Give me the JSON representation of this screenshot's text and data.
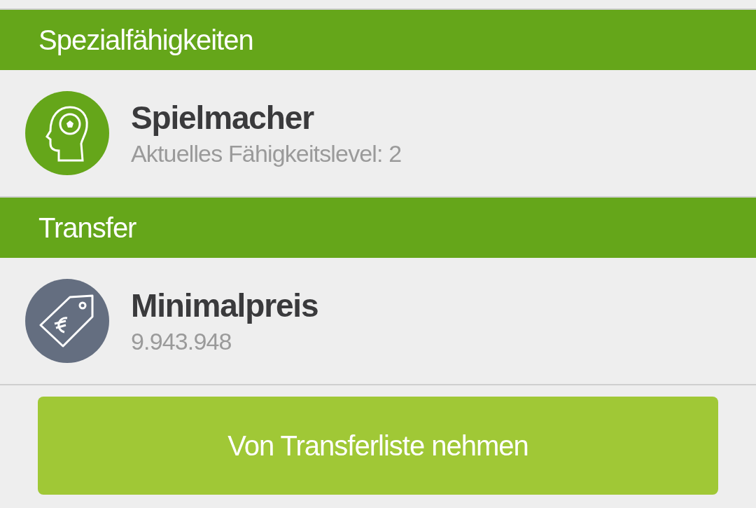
{
  "sections": [
    {
      "title": "Spezialfähigkeiten",
      "items": [
        {
          "kind": "skill",
          "color": "#65a61a",
          "name": "Spielmacher",
          "detail": "Aktuelles Fähigkeitslevel: 2"
        }
      ]
    },
    {
      "title": "Transfer",
      "items": [
        {
          "kind": "price",
          "color": "#646e80",
          "name": "Minimalpreis",
          "detail": "9.943.948"
        }
      ]
    }
  ],
  "button": {
    "label": "Von Transferliste nehmen"
  }
}
